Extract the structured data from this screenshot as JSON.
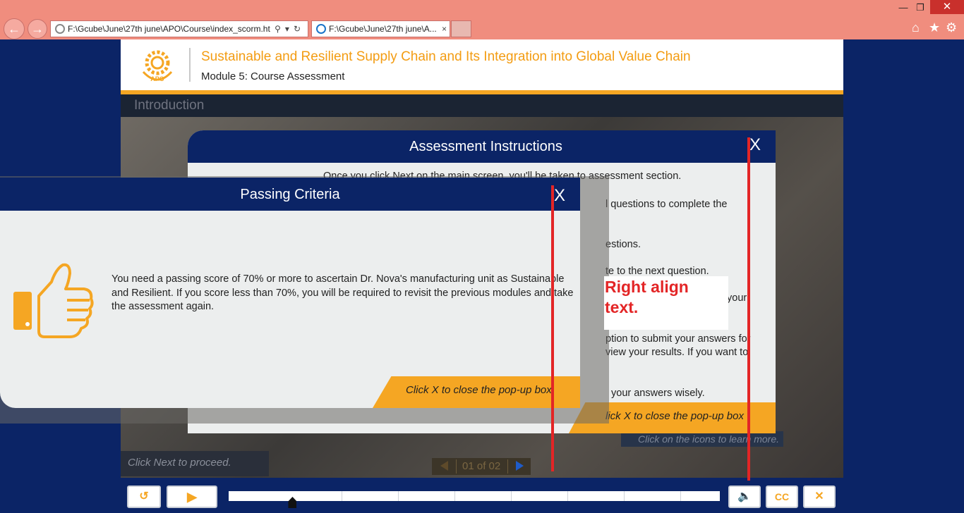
{
  "browser": {
    "address_url": "F:\\Gcube\\June\\27th june\\APO\\Course\\index_scorm.ht",
    "tab_title": "F:\\Gcube\\June\\27th june\\A...",
    "tab_close": "×",
    "window_min": "—",
    "window_restore": "❐",
    "window_close": "✕"
  },
  "course": {
    "logo_text": "APO",
    "title": "Sustainable and Resilient Supply Chain and Its Integration into Global Value Chain",
    "module": "Module 5: Course Assessment",
    "section": "Introduction",
    "click_next": "Click Next to proceed.",
    "click_icons": "Click on the icons to learn more.",
    "pager": "01 of 02"
  },
  "assessment_modal": {
    "title": "Assessment Instructions",
    "close": "X",
    "lines": [
      "Once you click Next on the main screen, you'll be taken to assessment section.",
      "l questions to complete the",
      "estions.",
      "te to the next question.",
      "your",
      "ption to submit your answers for",
      "view your results. If you want to",
      "your answers wisely."
    ],
    "footer": "lick X to close the pop-up box"
  },
  "annotation": {
    "text": "Right align text."
  },
  "passing_modal": {
    "title": "Passing Criteria",
    "close": "X",
    "body": "You need a passing score of 70% or more to ascertain Dr. Nova's manufacturing unit as Sustainable and Resilient. If you score less than 70%, you will be required to revisit the previous modules and take the assessment again.",
    "footer": "Click X to close the pop-up box"
  },
  "player": {
    "exit_icon": "exit-icon",
    "play_icon": "play-icon",
    "audio_icon": "speaker-icon",
    "cc_label": "CC",
    "close_label": "✕",
    "progress": 0.13
  }
}
